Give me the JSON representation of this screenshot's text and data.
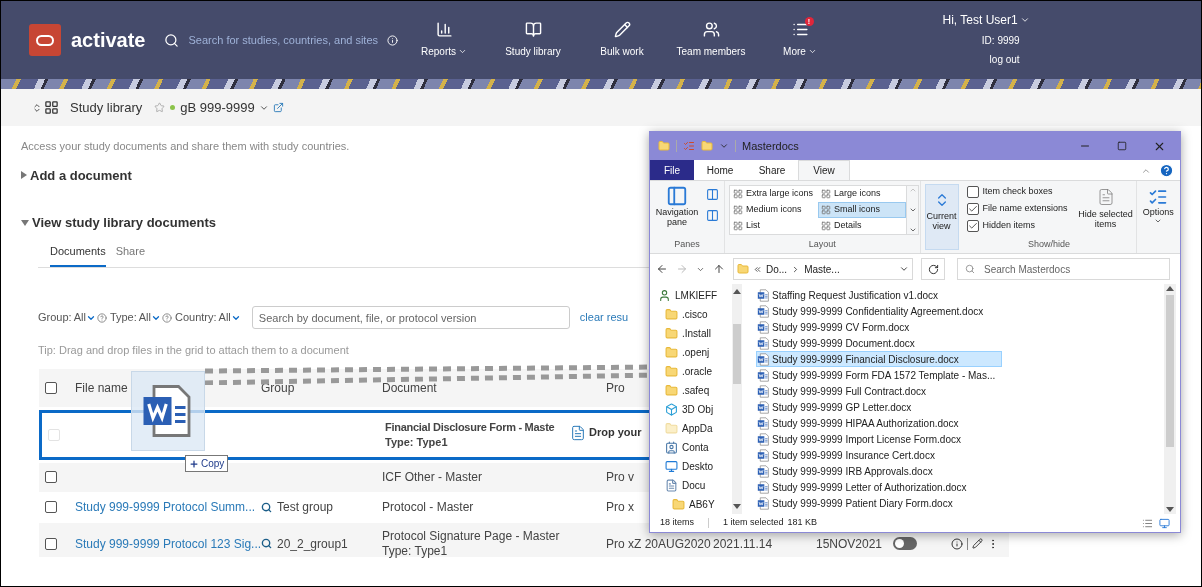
{
  "header": {
    "logo": "activate",
    "search_placeholder": "Search for studies, countries, and sites",
    "nav": [
      {
        "label": "Reports",
        "kind": "chart",
        "dropdown": true
      },
      {
        "label": "Study library",
        "kind": "book",
        "dropdown": false
      },
      {
        "label": "Bulk work",
        "kind": "pencil",
        "dropdown": false
      },
      {
        "label": "Team members",
        "kind": "users",
        "dropdown": false
      },
      {
        "label": "More",
        "kind": "list",
        "dropdown": true,
        "badge": "!"
      }
    ],
    "user": {
      "greeting": "Hi, Test User1",
      "id": "ID: 9999",
      "logout": "log out"
    }
  },
  "breadcrumb": {
    "title": "Study library",
    "favorite": false,
    "study": "gB 999-9999"
  },
  "intro": "Access your study documents and share them with study countries.",
  "sections": [
    {
      "title": "Add a document",
      "expanded": false
    },
    {
      "title": "View study library documents",
      "expanded": true
    }
  ],
  "tabs": [
    {
      "label": "Documents",
      "selected": true
    },
    {
      "label": "Share",
      "selected": false
    }
  ],
  "filters": [
    {
      "label": "Group:",
      "value": "All",
      "help": true
    },
    {
      "label": "Type:",
      "value": "All",
      "help": true
    },
    {
      "label": "Country:",
      "value": "All",
      "help": false
    }
  ],
  "search_placeholder": "Search by document, file, or protocol version",
  "clear_link": "clear resu",
  "tip": "Tip: Drag and drop files in the grid to attach them to a document",
  "table": {
    "header_checked": false,
    "columns": [
      "File name",
      "Group",
      "Document",
      "Pro"
    ],
    "rows": [
      {
        "kind": "drop-target",
        "checked": false,
        "disabled": true,
        "document": "Financial Disclosure Form - Maste",
        "document_type": "Type: Type1",
        "drop_hint": "Drop your"
      },
      {
        "kind": "row",
        "checked": false,
        "document": "ICF Other - Master",
        "column_4": "Pro v"
      },
      {
        "kind": "row",
        "checked": false,
        "file": "Study 999-9999 Protocol Summ...",
        "group": "Test group",
        "document": "Protocol - Master",
        "column_4": "Pro x"
      },
      {
        "kind": "row",
        "checked": false,
        "file": "Study 999-9999 Protocol 123 Sig...",
        "group": "20_2_group1",
        "document": "Protocol Signature Page - Master",
        "document_type": "Type: Type1",
        "column_4": "Pro xZ 20AUG2020",
        "column_5": "2021.11.14",
        "column_6": "15NOV2021",
        "toggle_on": false,
        "actions": true
      }
    ]
  },
  "drag": {
    "action": "Copy"
  },
  "explorer": {
    "title": "Masterdocs",
    "ribbon_tabs": [
      {
        "label": "File",
        "kind": "file",
        "selected": false
      },
      {
        "label": "Home",
        "kind": "tab",
        "selected": false
      },
      {
        "label": "Share",
        "kind": "tab",
        "selected": false
      },
      {
        "label": "View",
        "kind": "tab",
        "selected": true
      }
    ],
    "panes": {
      "nav_pane": "Navigation pane",
      "group": "Panes"
    },
    "layout": {
      "group": "Layout",
      "options": [
        {
          "label": "Extra large icons",
          "selected": false
        },
        {
          "label": "Large icons",
          "selected": false
        },
        {
          "label": "Medium icons",
          "selected": false
        },
        {
          "label": "Small icons",
          "selected": true
        },
        {
          "label": "List",
          "selected": false
        },
        {
          "label": "Details",
          "selected": false
        }
      ]
    },
    "current_view": "Current view",
    "show_hide": {
      "group": "Show/hide",
      "options": [
        {
          "label": "Item check boxes",
          "checked": false
        },
        {
          "label": "File name extensions",
          "checked": true
        },
        {
          "label": "Hidden items",
          "checked": true
        }
      ],
      "hide_selected": "Hide selected items"
    },
    "options": "Options",
    "address": {
      "path": [
        "Do...",
        "Maste..."
      ],
      "search_placeholder": "Search Masterdocs"
    },
    "nav_pane": [
      {
        "label": "LMKIEFF",
        "kind": "user",
        "children": [
          {
            "label": ".cisco",
            "kind": "folder"
          },
          {
            "label": ".Install",
            "kind": "folder"
          },
          {
            "label": ".openj",
            "kind": "folder"
          },
          {
            "label": ".oracle",
            "kind": "folder"
          },
          {
            "label": ".safeq",
            "kind": "folder"
          },
          {
            "label": "3D Obj",
            "kind": "cube"
          },
          {
            "label": "AppDa",
            "kind": "folder-light"
          },
          {
            "label": "Conta",
            "kind": "contacts"
          },
          {
            "label": "Deskto",
            "kind": "desktop"
          },
          {
            "label": "Docu",
            "kind": "documents",
            "children": [
              {
                "label": "AB6Y",
                "kind": "folder"
              }
            ]
          }
        ]
      }
    ],
    "files": [
      {
        "name": "Staffing Request Justification v1.docx",
        "selected": false
      },
      {
        "name": "Study 999-9999 Confidentiality Agreement.docx",
        "selected": false
      },
      {
        "name": "Study 999-9999 CV Form.docx",
        "selected": false
      },
      {
        "name": "Study 999-9999 Document.docx",
        "selected": false
      },
      {
        "name": "Study 999-9999 Financial Disclosure.docx",
        "selected": true
      },
      {
        "name": "Study 999-9999 Form FDA 1572 Template - Mas...",
        "selected": false
      },
      {
        "name": "Study 999-9999 Full Contract.docx",
        "selected": false
      },
      {
        "name": "Study 999-9999 GP Letter.docx",
        "selected": false
      },
      {
        "name": "Study 999-9999 HIPAA Authorization.docx",
        "selected": false
      },
      {
        "name": "Study 999-9999 Import License Form.docx",
        "selected": false
      },
      {
        "name": "Study 999-9999 Insurance Cert.docx",
        "selected": false
      },
      {
        "name": "Study 999-9999 IRB Approvals.docx",
        "selected": false
      },
      {
        "name": "Study 999-9999 Letter of Authorization.docx",
        "selected": false
      },
      {
        "name": "Study 999-9999 Patient Diary Form.docx",
        "selected": false
      }
    ],
    "status": {
      "count": "18 items",
      "selection": "1 item selected",
      "size": "181 KB"
    }
  }
}
